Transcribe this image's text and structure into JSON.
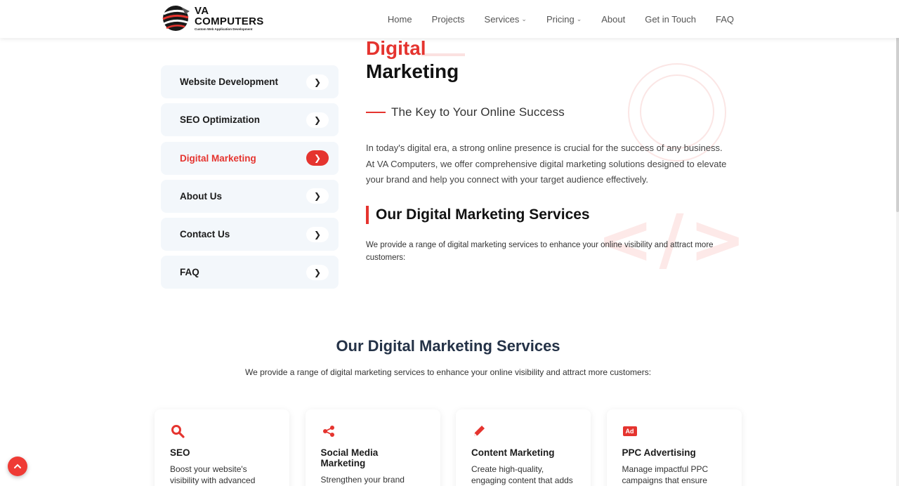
{
  "brand": {
    "line1": "VA",
    "line2": "COMPUTERS",
    "tagline": "Custom Web Application Development"
  },
  "nav": [
    {
      "label": "Home"
    },
    {
      "label": "Projects"
    },
    {
      "label": "Services",
      "has_dropdown": true
    },
    {
      "label": "Pricing",
      "has_dropdown": true
    },
    {
      "label": "About"
    },
    {
      "label": "Get in Touch"
    },
    {
      "label": "FAQ"
    }
  ],
  "sidebar": {
    "items": [
      {
        "label": "Website Development",
        "active": false
      },
      {
        "label": "SEO Optimization",
        "active": false
      },
      {
        "label": "Digital Marketing",
        "active": true
      },
      {
        "label": "About Us",
        "active": false
      },
      {
        "label": "Contact Us",
        "active": false
      },
      {
        "label": "FAQ",
        "active": false
      }
    ]
  },
  "hero": {
    "title_red": "Digital",
    "title_black": "Marketing",
    "tagline": "The Key to Your Online Success",
    "intro": "In today's digital era, a strong online presence is crucial for the success of any business. At VA Computers, we offer comprehensive digital marketing solutions designed to elevate your brand and help you connect with your target audience effectively.",
    "services_heading": "Our Digital Marketing Services",
    "services_desc": "We provide a range of digital marketing services to enhance your online visibility and attract more customers:"
  },
  "section2": {
    "title": "Our Digital Marketing Services",
    "desc": "We provide a range of digital marketing services to enhance your online visibility and attract more customers:",
    "cards": [
      {
        "icon": "search-icon",
        "title": "SEO",
        "desc": "Boost your website's visibility with advanced SEO"
      },
      {
        "icon": "share-icon",
        "title": "Social Media Marketing",
        "desc": "Strengthen your brand presence on social media"
      },
      {
        "icon": "pencil-icon",
        "title": "Content Marketing",
        "desc": "Create high-quality, engaging content that adds"
      },
      {
        "icon": "ad-icon",
        "title": "PPC Advertising",
        "icon_text": "Ad",
        "desc": "Manage impactful PPC campaigns that ensure"
      }
    ]
  },
  "colors": {
    "accent": "#e5342f",
    "sidebar_bg": "#f3f7fb",
    "heading_dark": "#243247"
  }
}
